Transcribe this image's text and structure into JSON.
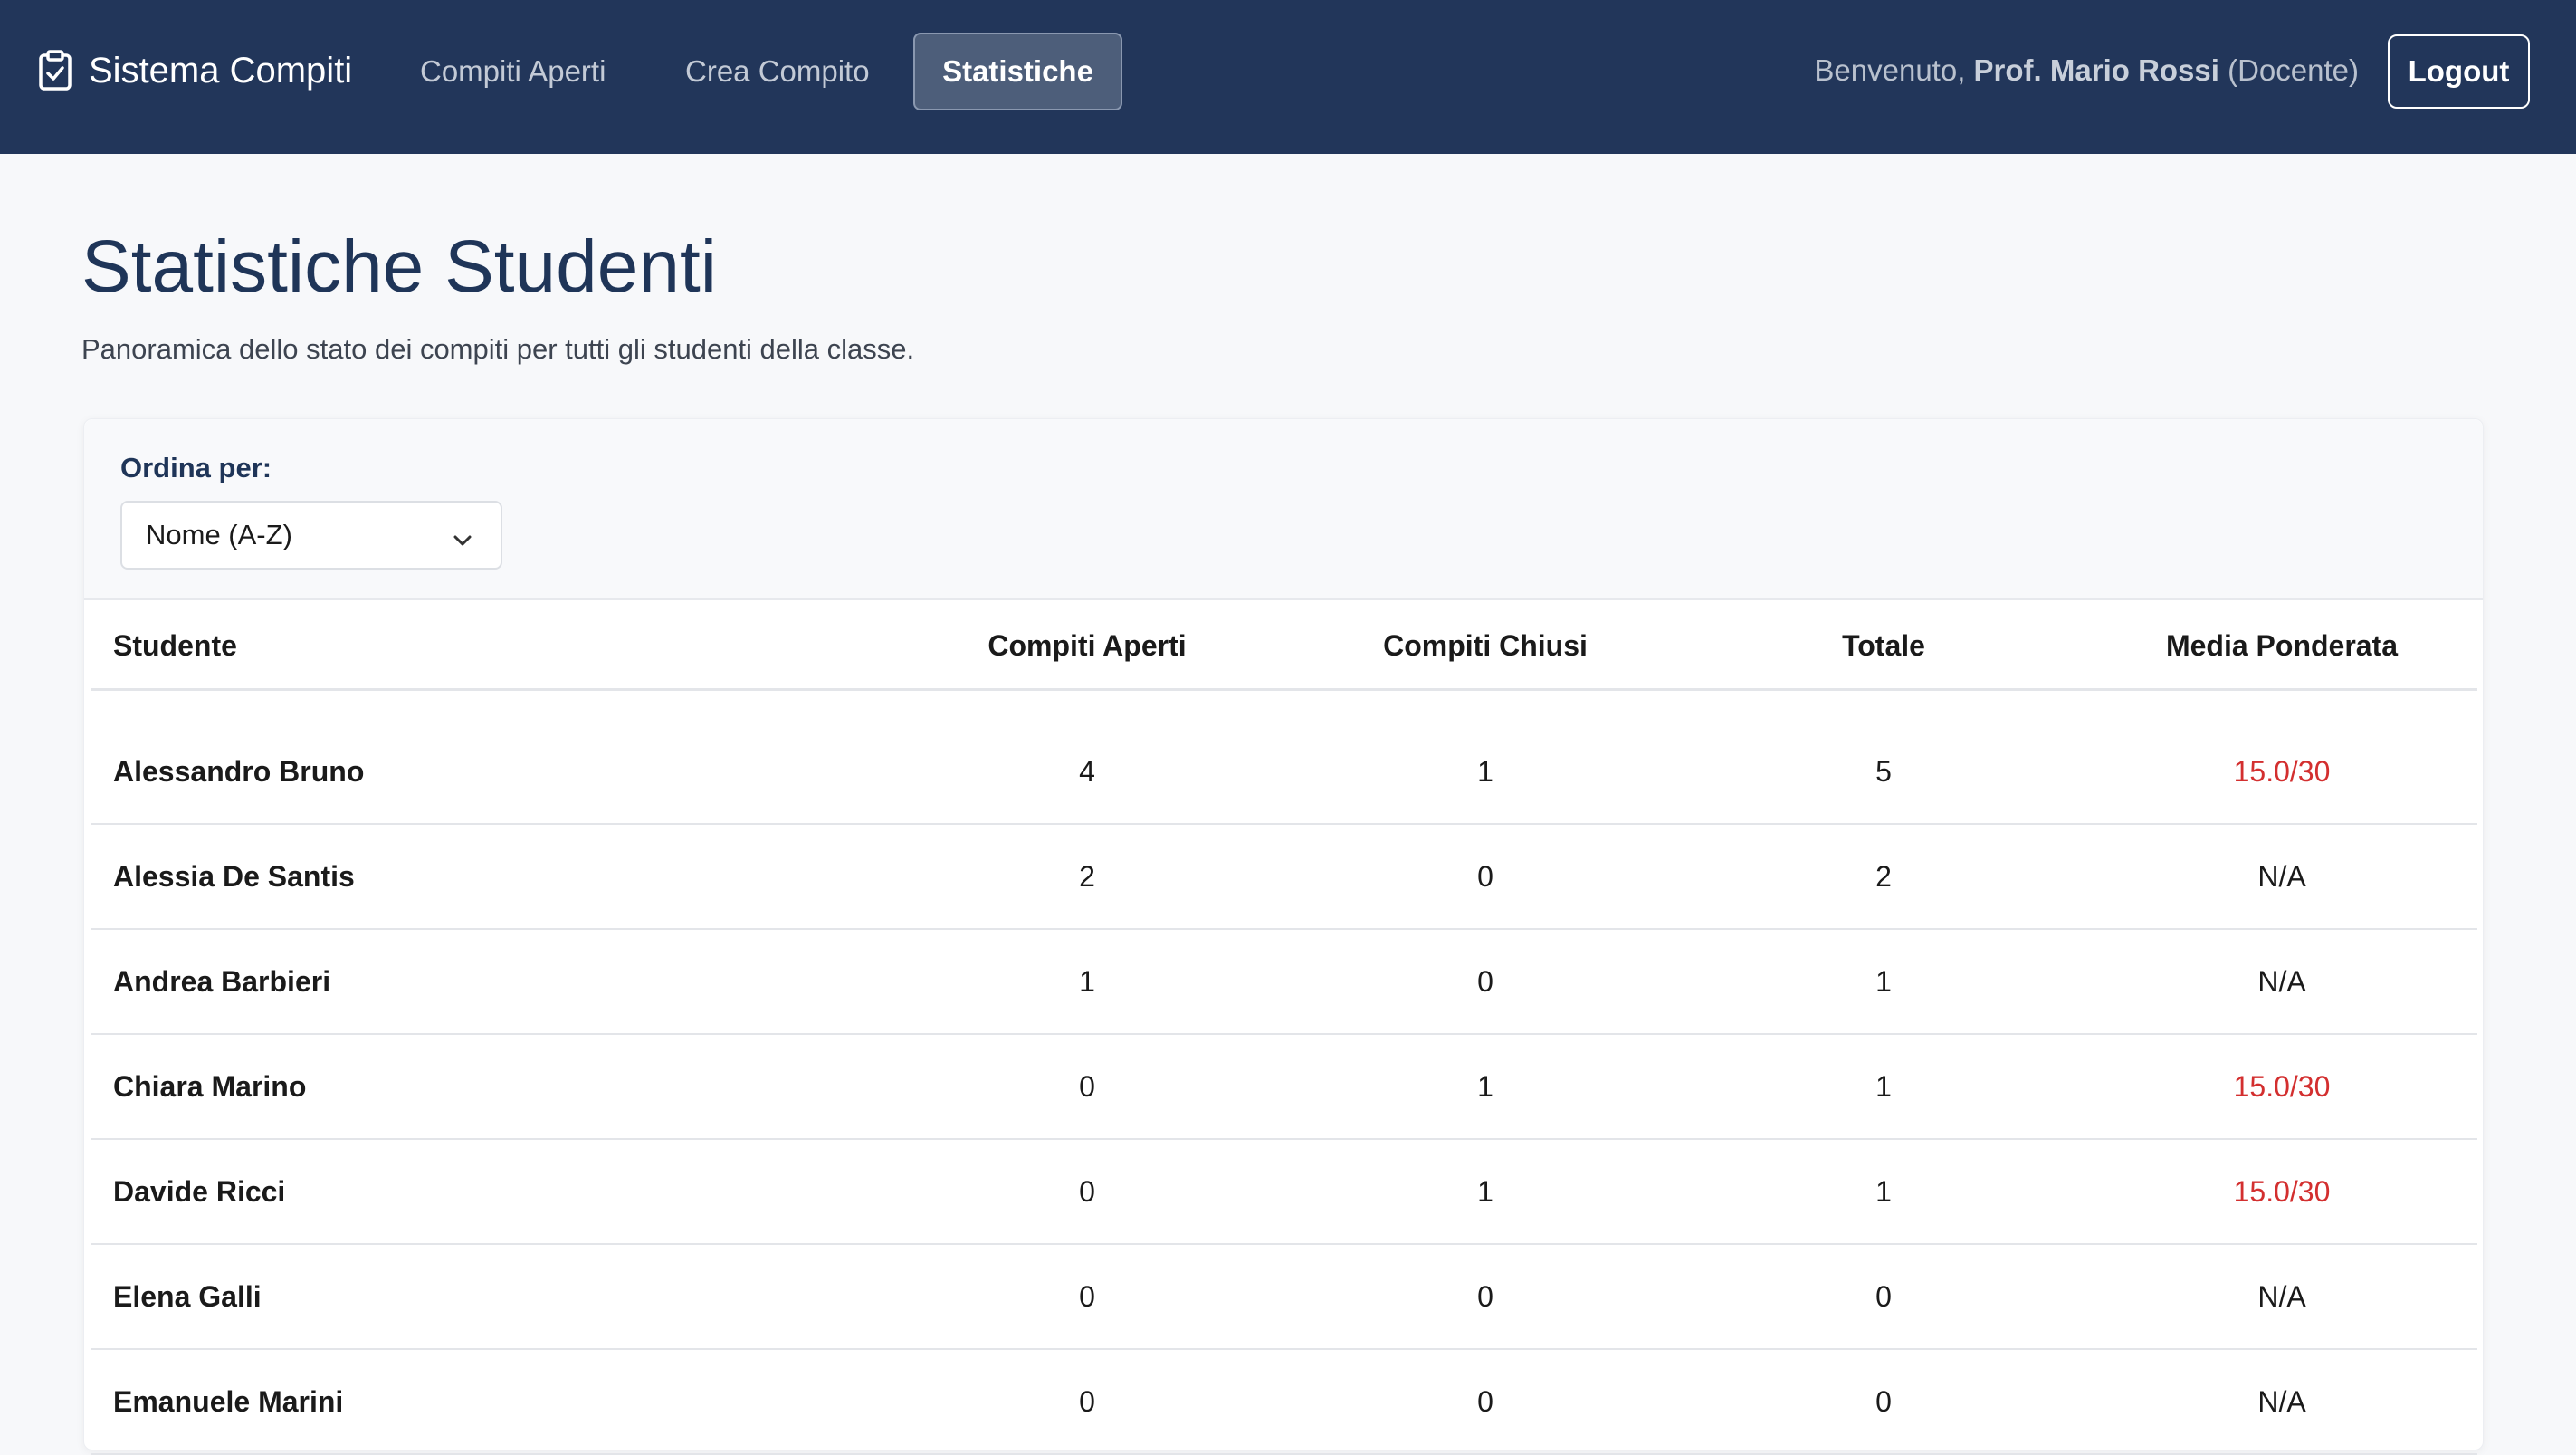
{
  "nav": {
    "brand": "Sistema Compiti",
    "links": [
      "Compiti Aperti",
      "Crea Compito",
      "Statistiche"
    ],
    "active_link": "Statistiche",
    "welcome_prefix": "Benvenuto, ",
    "user_name": "Prof. Mario Rossi",
    "user_role": " (Docente)",
    "logout_label": "Logout"
  },
  "page": {
    "title": "Statistiche Studenti",
    "subtitle": "Panoramica dello stato dei compiti per tutti gli studenti della classe."
  },
  "filter": {
    "label": "Ordina per:",
    "selected": "Nome (A-Z)"
  },
  "table": {
    "headers": [
      "Studente",
      "Compiti Aperti",
      "Compiti Chiusi",
      "Totale",
      "Media Ponderata"
    ],
    "rows": [
      {
        "name": "Alessandro Bruno",
        "open": "4",
        "closed": "1",
        "total": "5",
        "avg": "15.0/30",
        "avg_status": "low"
      },
      {
        "name": "Alessia De Santis",
        "open": "2",
        "closed": "0",
        "total": "2",
        "avg": "N/A",
        "avg_status": "none"
      },
      {
        "name": "Andrea Barbieri",
        "open": "1",
        "closed": "0",
        "total": "1",
        "avg": "N/A",
        "avg_status": "none"
      },
      {
        "name": "Chiara Marino",
        "open": "0",
        "closed": "1",
        "total": "1",
        "avg": "15.0/30",
        "avg_status": "low"
      },
      {
        "name": "Davide Ricci",
        "open": "0",
        "closed": "1",
        "total": "1",
        "avg": "15.0/30",
        "avg_status": "low"
      },
      {
        "name": "Elena Galli",
        "open": "0",
        "closed": "0",
        "total": "0",
        "avg": "N/A",
        "avg_status": "none"
      },
      {
        "name": "Emanuele Marini",
        "open": "0",
        "closed": "0",
        "total": "0",
        "avg": "N/A",
        "avg_status": "none"
      }
    ]
  },
  "colors": {
    "navbar_bg": "#22365a",
    "accent_title": "#1f3558",
    "grade_low": "#d32f2f"
  },
  "icons": {
    "brand": "clipboard-check-icon",
    "select": "chevron-down-icon"
  }
}
